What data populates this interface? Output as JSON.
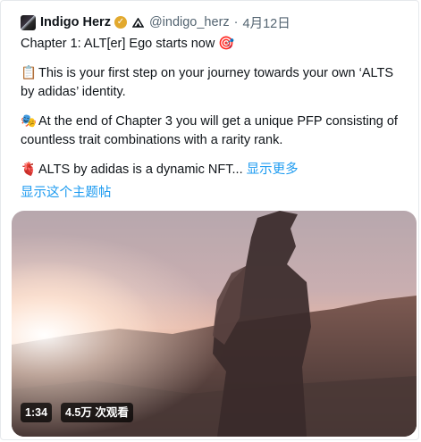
{
  "author": {
    "display_name": "Indigo Herz",
    "handle": "@indigo_herz",
    "separator": "·",
    "date": "4月12日"
  },
  "tweet": {
    "line1": "Chapter 1: ALT[er] Ego starts now",
    "emoji1": "🎯",
    "para2_emoji": "📋",
    "para2": "This is your first step on your journey towards your own ‘ALTS by adidas’ identity.",
    "para3_emoji": "🎭",
    "para3": "At the end of Chapter 3 you will get a unique PFP consisting of countless trait combinations with a rarity rank.",
    "para4_emoji": "🫀",
    "para4": "ALTS by adidas is a dynamic NFT...",
    "show_more": "显示更多"
  },
  "show_thread": "显示这个主题帖",
  "video": {
    "duration": "1:34",
    "views": "4.5万 次观看"
  },
  "colors": {
    "link": "#1d9bf0",
    "muted": "#536471",
    "badge": "#e2a92e"
  }
}
